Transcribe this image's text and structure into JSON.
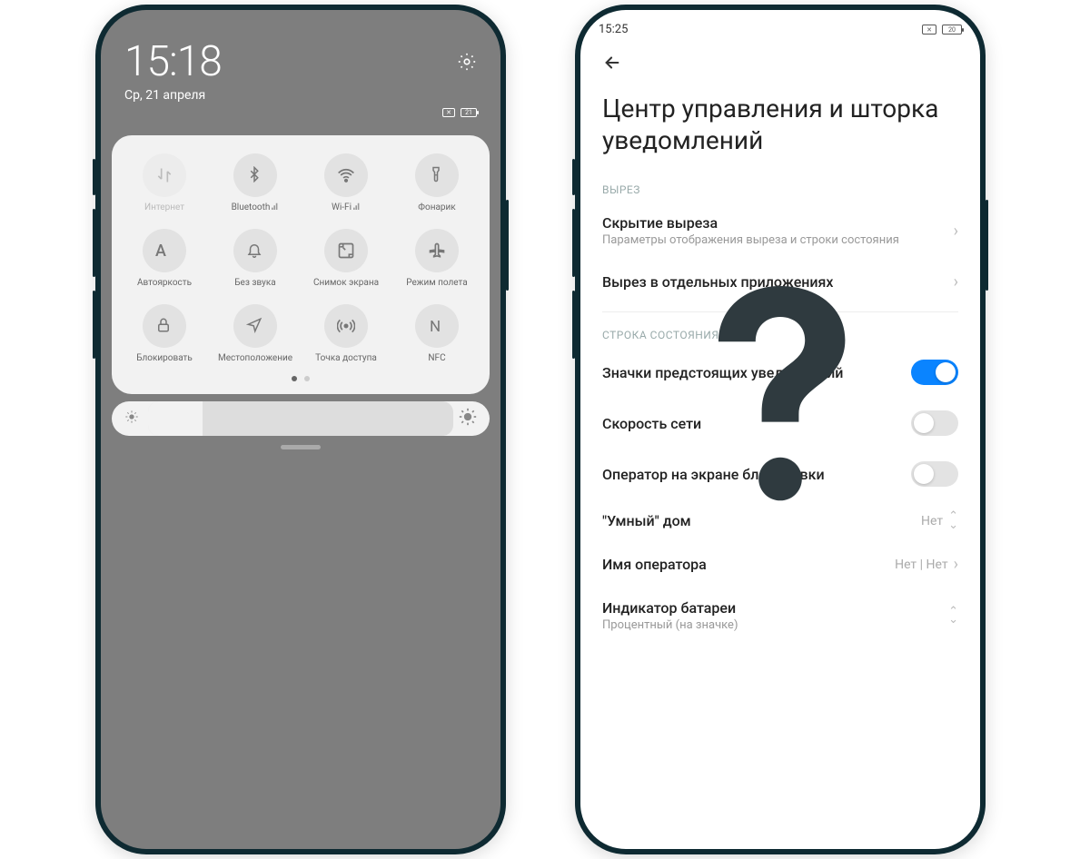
{
  "left": {
    "time": "15:18",
    "date": "Ср, 21 апреля",
    "battery": "21",
    "qs": [
      {
        "label": "Интернет",
        "icon": "data-swap",
        "dim": true
      },
      {
        "label": "Bluetooth",
        "icon": "bluetooth",
        "signal": true
      },
      {
        "label": "Wi-Fi",
        "icon": "wifi",
        "signal": true
      },
      {
        "label": "Фонарик",
        "icon": "flashlight"
      },
      {
        "label": "Автояркость",
        "icon": "auto-brightness"
      },
      {
        "label": "Без звука",
        "icon": "bell"
      },
      {
        "label": "Снимок экрана",
        "icon": "screenshot"
      },
      {
        "label": "Режим полета",
        "icon": "airplane"
      },
      {
        "label": "Блокировать",
        "icon": "lock"
      },
      {
        "label": "Местоположение",
        "icon": "location"
      },
      {
        "label": "Точка доступа",
        "icon": "hotspot"
      },
      {
        "label": "NFC",
        "icon": "nfc"
      }
    ]
  },
  "right": {
    "time": "15:25",
    "battery": "20",
    "title": "Центр управления и шторка уведомлений",
    "section1": "ВЫРЕЗ",
    "item_notch_hide": "Скрытие выреза",
    "item_notch_hide_sub": "Параметры отображения выреза и строки состояния",
    "item_notch_apps": "Вырез в отдельных приложениях",
    "section2": "СТРОКА СОСТОЯНИЯ",
    "item_icons": "Значки предстоящих уведомлений",
    "item_netspeed": "Скорость сети",
    "item_carrier_lock": "Оператор на экране блокировки",
    "item_smart_home": "\"Умный\" дом",
    "item_smart_home_val": "Нет",
    "item_carrier_name": "Имя оператора",
    "item_carrier_name_val": "Нет | Нет",
    "item_battery": "Индикатор батареи",
    "item_battery_sub": "Процентный (на значке)",
    "toggles": {
      "icons": true,
      "netspeed": false,
      "carrier_lock": false
    }
  }
}
